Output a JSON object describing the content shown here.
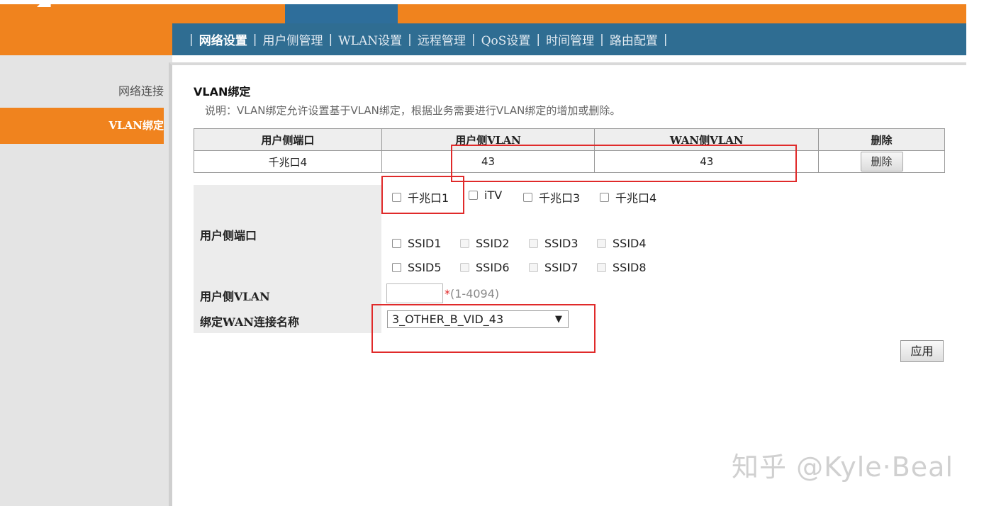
{
  "header": {
    "nav": [
      {
        "label": "网络设置",
        "active": true
      },
      {
        "label": "用户侧管理"
      },
      {
        "label": "WLAN设置"
      },
      {
        "label": "远程管理"
      },
      {
        "label": "QoS设置"
      },
      {
        "label": "时间管理"
      },
      {
        "label": "路由配置"
      }
    ],
    "separator": "|"
  },
  "sidebar": {
    "items": [
      {
        "label": "网络连接"
      },
      {
        "label": "VLAN绑定",
        "active": true
      }
    ]
  },
  "main": {
    "title": "VLAN绑定",
    "description": "说明：VLAN绑定允许设置基于VLAN绑定，根据业务需要进行VLAN绑定的增加或删除。",
    "table": {
      "headers": [
        "用户侧端口",
        "用户侧VLAN",
        "WAN侧VLAN",
        "删除"
      ],
      "rows": [
        {
          "port": "千兆口4",
          "user_vlan": "43",
          "wan_vlan": "43",
          "delete_label": "删除"
        }
      ]
    },
    "form": {
      "port_label": "用户侧端口",
      "lan_ports": [
        "千兆口1",
        "iTV",
        "千兆口3",
        "千兆口4"
      ],
      "ssids": [
        "SSID1",
        "SSID2",
        "SSID3",
        "SSID4",
        "SSID5",
        "SSID6",
        "SSID7",
        "SSID8"
      ],
      "vlan_label": "用户侧VLAN",
      "vlan_value": "",
      "vlan_required": "*",
      "vlan_hint": "(1-4094)",
      "wan_label": "绑定WAN连接名称",
      "wan_selected": "3_OTHER_B_VID_43",
      "wan_arrow": "▼",
      "apply_label": "应用"
    }
  },
  "watermark": "知乎 @Kyle·Beal",
  "colors": {
    "orange": "#f0831e",
    "nav_blue": "#2f6d92",
    "annotation_red": "#e02a2a"
  }
}
